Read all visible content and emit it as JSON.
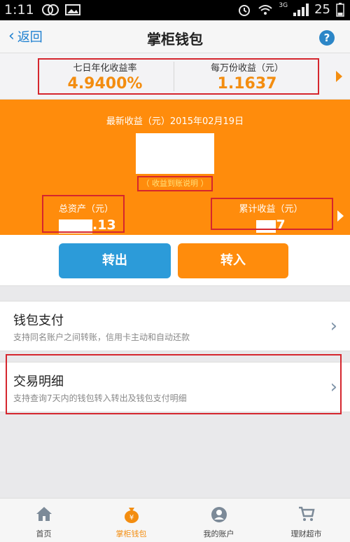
{
  "status_bar": {
    "time": "1:11",
    "network": "3G",
    "battery": "25"
  },
  "header": {
    "back_label": "返回",
    "title": "掌柜钱包",
    "help_icon": "question-icon"
  },
  "yields": {
    "seven_day_label": "七日年化收益率",
    "seven_day_value": "4.9400%",
    "per_10k_label": "每万份收益（元）",
    "per_10k_value": "1.1637"
  },
  "earnings": {
    "latest_label": "最新收益（元）2015年02月19日",
    "explain_label": "（ 收益到账说明 ）",
    "total_assets_label": "总资产（元）",
    "total_assets_value_suffix": ".13",
    "cumulative_label": "累计收益（元）",
    "cumulative_value_suffix": "7"
  },
  "actions": {
    "transfer_out": "转出",
    "transfer_in": "转入"
  },
  "list": [
    {
      "title": "钱包支付",
      "subtitle": "支持同名账户之间转账，信用卡主动和自动还款"
    },
    {
      "title": "交易明细",
      "subtitle": "支持查询7天内的钱包转入转出及钱包支付明细"
    }
  ],
  "nav": [
    {
      "label": "首页",
      "icon": "home-icon"
    },
    {
      "label": "掌柜钱包",
      "icon": "money-bag-icon"
    },
    {
      "label": "我的账户",
      "icon": "account-icon"
    },
    {
      "label": "理财超市",
      "icon": "cart-icon"
    }
  ],
  "colors": {
    "accent": "#ff8c0c",
    "blue": "#2c9bd9",
    "highlight": "#d5262e"
  }
}
